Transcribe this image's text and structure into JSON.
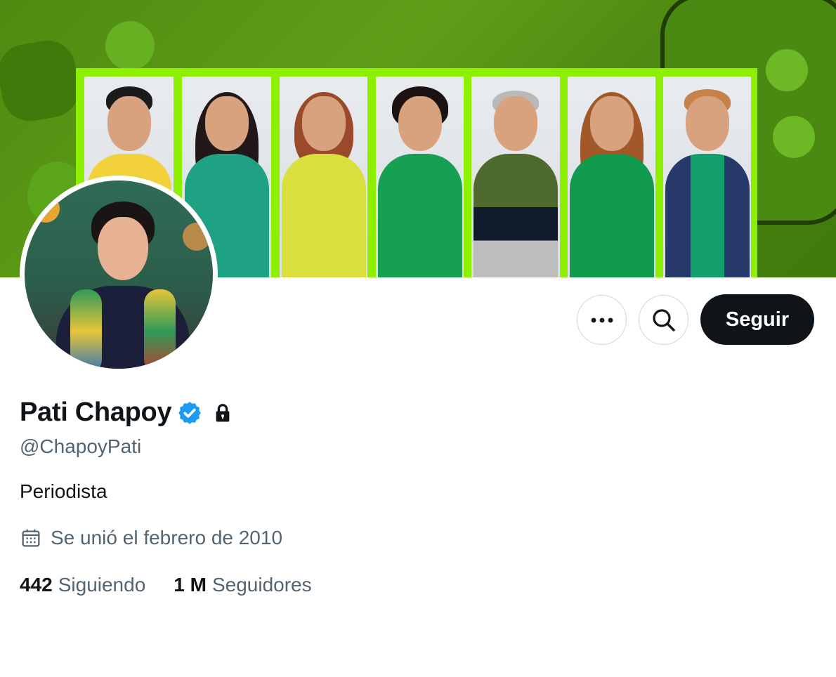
{
  "profile": {
    "name": "Pati Chapoy",
    "handle": "@ChapoyPati",
    "bio": "Periodista",
    "joined": "Se unió el febrero de 2010",
    "verified": true,
    "protected": true
  },
  "actions": {
    "more_icon": "more-horizontal-icon",
    "search_icon": "search-icon",
    "follow_label": "Seguir"
  },
  "stats": {
    "following_count": "442",
    "following_label": "Siguiendo",
    "followers_count": "1 M",
    "followers_label": "Seguidores"
  },
  "colors": {
    "accent_verified": "#1d9bf0",
    "banner_green": "#4f8a10",
    "frame_lime": "#8cf000",
    "text_primary": "#0f1419",
    "text_secondary": "#536471"
  }
}
